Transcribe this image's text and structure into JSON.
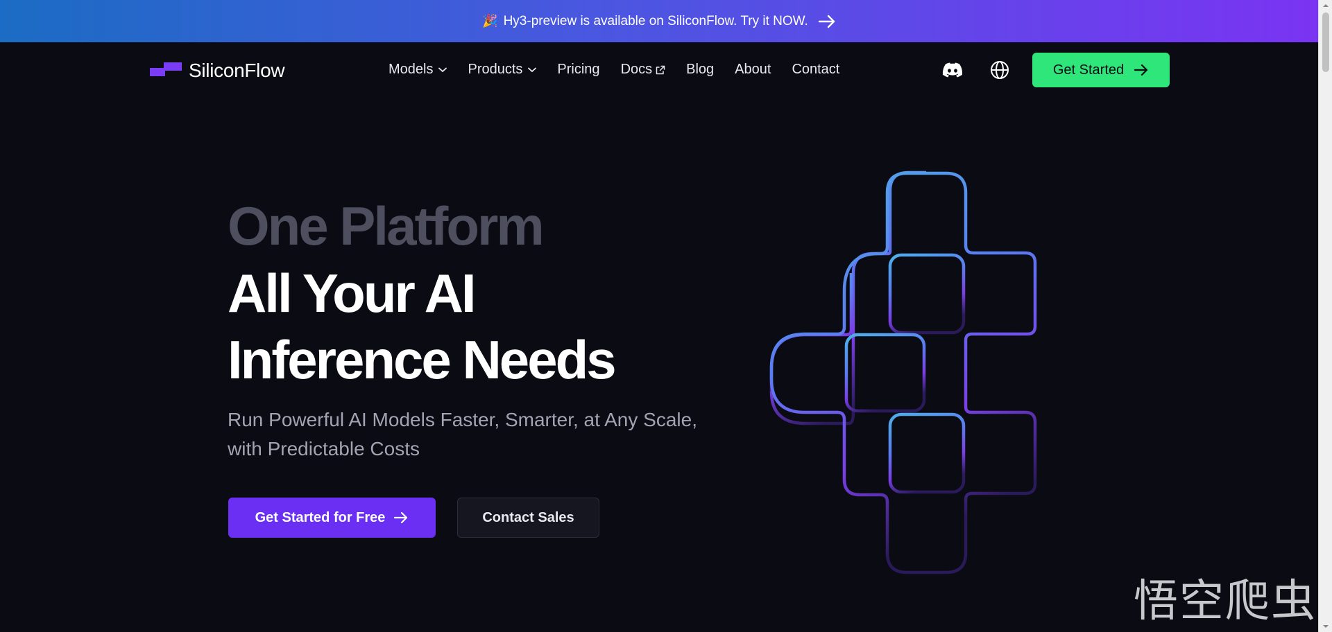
{
  "banner": {
    "emoji": "🎉",
    "text": "Hy3-preview is available on SiliconFlow. Try it NOW."
  },
  "nav": {
    "logo_text": "SiliconFlow",
    "items": [
      {
        "label": "Models",
        "has_dropdown": true
      },
      {
        "label": "Products",
        "has_dropdown": true
      },
      {
        "label": "Pricing"
      },
      {
        "label": "Docs",
        "external": true
      },
      {
        "label": "Blog"
      },
      {
        "label": "About"
      },
      {
        "label": "Contact"
      }
    ],
    "icons": [
      "discord-icon",
      "globe-icon"
    ],
    "cta_label": "Get Started"
  },
  "hero": {
    "line1": "One Platform",
    "line2": "All Your AI",
    "line3": "Inference Needs",
    "subtitle": "Run Powerful AI Models Faster, Smarter, at Any Scale,  with Predictable Costs",
    "primary_button": "Get Started for Free",
    "secondary_button": "Contact Sales"
  },
  "watermark": "悟空爬虫",
  "colors": {
    "background": "#0a0b13",
    "accent_green": "#2ee67a",
    "accent_purple": "#6a2ff2",
    "banner_start": "#1b6cc4",
    "banner_end": "#7a34f2"
  }
}
